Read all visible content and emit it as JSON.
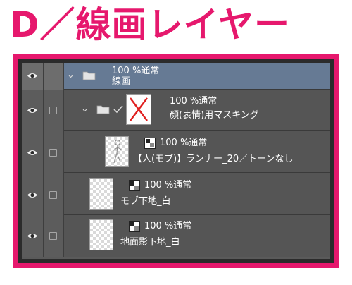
{
  "heading": "D／線画レイヤー",
  "layers": [
    {
      "id": "lineart",
      "opacity_blend": "100 %通常",
      "name": "線画"
    },
    {
      "id": "face",
      "opacity_blend": "100 %通常",
      "name": "顔(表情)用マスキング"
    },
    {
      "id": "mob",
      "opacity_blend": "100 %通常",
      "name": "【人(モブ)】ランナー_20／トーンなし"
    },
    {
      "id": "mob-base",
      "opacity_blend": "100 %通常",
      "name": "モブ下地_白"
    },
    {
      "id": "ground-shadow",
      "opacity_blend": "100 %通常",
      "name": "地面影下地_白"
    }
  ],
  "colors": {
    "accent": "#e6186d",
    "selected": "#667a94",
    "panel": "#555555"
  }
}
